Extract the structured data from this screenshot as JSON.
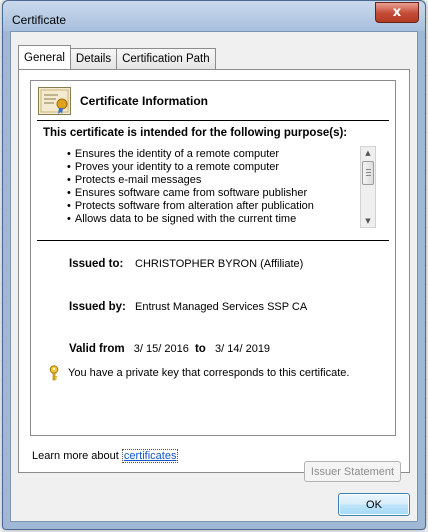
{
  "window": {
    "title": "Certificate",
    "close_glyph": "x"
  },
  "tabs": [
    {
      "label": "General",
      "active": true
    },
    {
      "label": "Details",
      "active": false
    },
    {
      "label": "Certification Path",
      "active": false
    }
  ],
  "info": {
    "title": "Certificate Information",
    "purpose_heading": "This certificate is intended for the following purpose(s):",
    "purposes": [
      "Ensures the identity of a remote computer",
      "Proves your identity to a remote computer",
      "Protects e-mail messages",
      "Ensures software came from software publisher",
      "Protects software from alteration after publication",
      "Allows data to be signed with the current time"
    ],
    "issued_to_label": "Issued to:",
    "issued_to_value": "CHRISTOPHER BYRON (Affiliate)",
    "issued_by_label": "Issued by:",
    "issued_by_value": "Entrust Managed Services SSP CA",
    "valid_from_label": "Valid from",
    "valid_from_value": "3/ 15/ 2016",
    "valid_to_label": "to",
    "valid_to_value": "3/ 14/ 2019",
    "private_key_text": "You have a private key that corresponds to this certificate."
  },
  "buttons": {
    "issuer_statement": "Issuer Statement",
    "ok": "OK"
  },
  "learn_more": {
    "prefix": "Learn more about ",
    "link": "certificates"
  },
  "colors": {
    "link": "#1155cc",
    "close_button": "#c44b36",
    "title_bar": "#a8c0dd"
  },
  "icons": {
    "certificate": "certificate-icon",
    "key": "key-icon",
    "close": "close-icon"
  }
}
